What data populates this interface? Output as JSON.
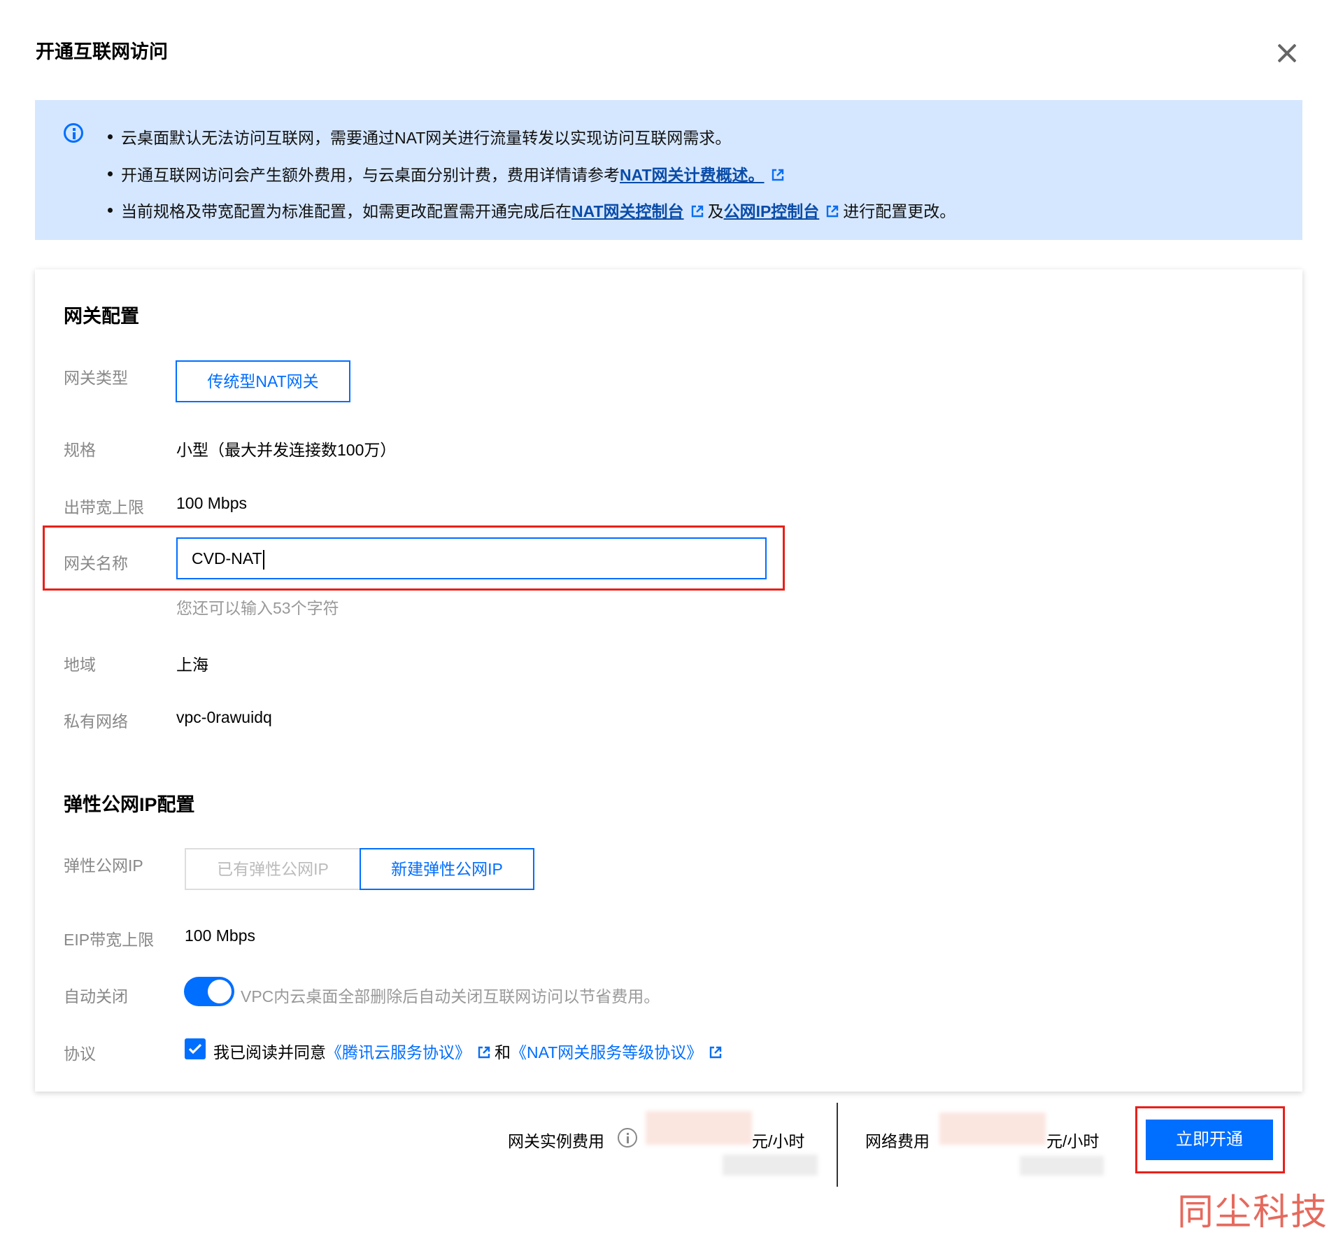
{
  "dialog": {
    "title": "开通互联网访问"
  },
  "notice": {
    "line1": "云桌面默认无法访问互联网，需要通过NAT网关进行流量转发以实现访问互联网需求。",
    "line2_prefix": "开通互联网访问会产生额外费用，与云桌面分别计费，费用详情请参考",
    "line2_link": "NAT网关计费概述。",
    "line3_prefix": "当前规格及带宽配置为标准配置，如需更改配置需开通完成后在",
    "line3_link1": "NAT网关控制台",
    "line3_middle": "及",
    "line3_link2": "公网IP控制台",
    "line3_suffix": "进行配置更改。"
  },
  "gateway": {
    "section_title": "网关配置",
    "type_label": "网关类型",
    "type_value": "传统型NAT网关",
    "spec_label": "规格",
    "spec_value": "小型（最大并发连接数100万）",
    "bandwidth_label": "出带宽上限",
    "bandwidth_value": "100 Mbps",
    "name_label": "网关名称",
    "name_value": "CVD-NAT",
    "name_hint": "您还可以输入53个字符",
    "region_label": "地域",
    "region_value": "上海",
    "vpc_label": "私有网络",
    "vpc_value": "vpc-0rawuidq"
  },
  "eip": {
    "section_title": "弹性公网IP配置",
    "eip_label": "弹性公网IP",
    "option_existing": "已有弹性公网IP",
    "option_new": "新建弹性公网IP",
    "selected_option": "新建弹性公网IP",
    "bandwidth_label": "EIP带宽上限",
    "bandwidth_value": "100 Mbps",
    "auto_close_label": "自动关闭",
    "auto_close_on": true,
    "auto_close_text": "VPC内云桌面全部删除后自动关闭互联网访问以节省费用。",
    "agreement_label": "协议",
    "agreement_checked": true,
    "agreement_prefix": "我已阅读并同意",
    "agreement_link1": "《腾讯云服务协议》",
    "agreement_middle": "和",
    "agreement_link2": "《NAT网关服务等级协议》"
  },
  "footer": {
    "instance_fee_label": "网关实例费用",
    "instance_fee_unit": "元/小时",
    "network_fee_label": "网络费用",
    "network_fee_unit": "元/小时",
    "open_button": "立即开通"
  },
  "watermark": "同尘科技",
  "colors": {
    "accent": "#006eff",
    "notice_bg": "#d5e7ff",
    "highlight_box": "#e8201a",
    "link_dark": "#0a4ca8"
  },
  "icons": [
    "close-icon",
    "info-icon",
    "external-link-icon",
    "question-info-icon",
    "check-icon"
  ]
}
